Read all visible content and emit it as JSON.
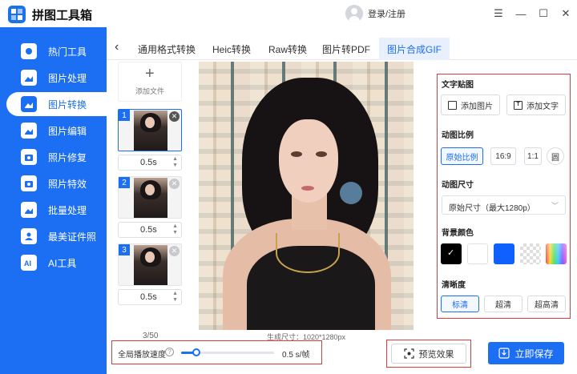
{
  "app": {
    "title": "拼图工具箱",
    "login_label": "登录/注册"
  },
  "window_controls": [
    "menu-icon",
    "minimize-icon",
    "maximize-icon",
    "close-icon"
  ],
  "sidebar": {
    "items": [
      {
        "label": "热门工具",
        "icon": "hot-tools-icon"
      },
      {
        "label": "图片处理",
        "icon": "image-process-icon"
      },
      {
        "label": "图片转换",
        "icon": "image-convert-icon",
        "active": true
      },
      {
        "label": "图片编辑",
        "icon": "image-edit-icon"
      },
      {
        "label": "照片修复",
        "icon": "photo-repair-icon"
      },
      {
        "label": "照片特效",
        "icon": "photo-effect-icon"
      },
      {
        "label": "批量处理",
        "icon": "batch-process-icon"
      },
      {
        "label": "最美证件照",
        "icon": "id-photo-icon"
      },
      {
        "label": "AI工具",
        "icon": "ai-tools-icon"
      }
    ]
  },
  "tabs": [
    {
      "label": "通用格式转换"
    },
    {
      "label": "Heic转换"
    },
    {
      "label": "Raw转换"
    },
    {
      "label": "图片转PDF"
    },
    {
      "label": "图片合成GIF",
      "active": true
    }
  ],
  "file_list": {
    "add_label": "添加文件",
    "frames": [
      {
        "num": "1",
        "duration": "0.5s",
        "selected": true
      },
      {
        "num": "2",
        "duration": "0.5s"
      },
      {
        "num": "3",
        "duration": "0.5s"
      }
    ],
    "counter": "3/50"
  },
  "preview": {
    "size_text": "生成尺寸：1020*1280px"
  },
  "settings": {
    "sticker": {
      "title": "文字贴图",
      "add_image": "添加图片",
      "add_text": "添加文字"
    },
    "ratio": {
      "title": "动图比例",
      "options": [
        "原始比例",
        "16:9",
        "1:1",
        "圆"
      ],
      "selected": "原始比例"
    },
    "size": {
      "title": "动图尺寸",
      "value": "原始尺寸（最大1280p）"
    },
    "bg_color": {
      "title": "背景颜色",
      "colors": [
        "#000000",
        "#ffffff",
        "#1060ff",
        "transparent",
        "gradient"
      ],
      "selected": "#000000"
    },
    "clarity": {
      "title": "清晰度",
      "options": [
        "标清",
        "超清",
        "超高清"
      ],
      "selected": "标清"
    }
  },
  "bottom": {
    "speed_label": "全局播放速度",
    "speed_value": "0.5 s/帧",
    "speed_fraction": 0.16,
    "preview_label": "预览效果",
    "save_label": "立即保存"
  }
}
